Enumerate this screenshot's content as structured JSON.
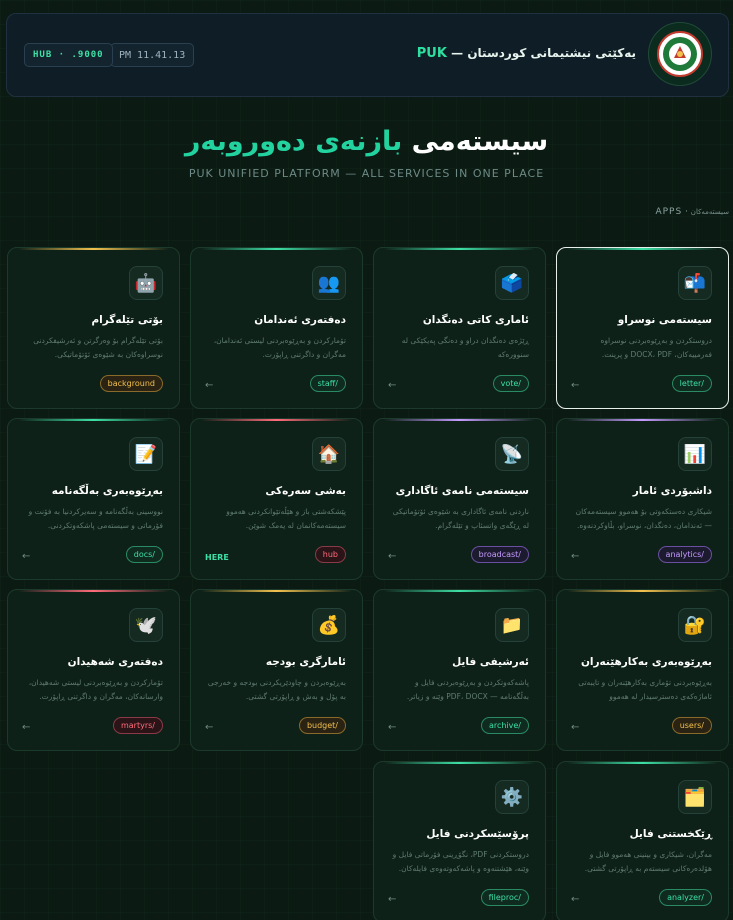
{
  "header": {
    "brand_name": "یەکێتی نیشتیمانی کوردستان",
    "brand_sep": " — ",
    "brand_short": "PUK",
    "time": "PM 11.41.13",
    "hub": "HUB · .9000"
  },
  "hero": {
    "title_part1": "سیستەمی",
    "title_part2": "بازنەی دەوروبەر",
    "subtitle": "PUK UNIFIED PLATFORM — ALL SERVICES IN ONE PLACE"
  },
  "apps_label": {
    "main": "APPS",
    "sep": " · ",
    "sub": "سیستەمەکان"
  },
  "cards": [
    {
      "title": "سیستەمی نوسراو",
      "desc": "دروستکردن و بەڕێوەبردنی نوسراوە فەرمییەکان، DOCX، PDF و پرینت.",
      "badge": "letter/",
      "arrow": "←",
      "icon": "📬",
      "icon_name": "mailbox-icon",
      "accent": "#3de0a6",
      "badge_style": "green"
    },
    {
      "title": "ئاماری کاتی دەنگدان",
      "desc": "ڕێژەی دەنگدان دراو و دەنگی پەیکێکی لە سنوورەکە",
      "badge": "vote/",
      "arrow": "←",
      "icon": "🗳️",
      "icon_name": "ballot-box-icon",
      "accent": "#3de0a6",
      "badge_style": "green"
    },
    {
      "title": "دەفتەری ئەندامان",
      "desc": "تۆمارکردن و بەڕێوەبردنی لیستی ئەندامان، مەگران و داگرتنی ڕاپۆرت.",
      "badge": "staff/",
      "arrow": "←",
      "icon": "👥",
      "icon_name": "people-icon",
      "accent": "#3de0a6",
      "badge_style": "green"
    },
    {
      "title": "بۆتی تێلەگرام",
      "desc": "بۆتی تێلەگرام بۆ وەرگرتن و ئەرشیفکردنی نوسراوەکان بە شێوەی ئۆتۆماتیکی.",
      "badge": "background",
      "arrow": "",
      "icon": "🤖",
      "icon_name": "robot-icon",
      "accent": "#f2c14e",
      "badge_style": "yellow"
    },
    {
      "title": "داشبۆردی ئامار",
      "desc": "شیکاری دەستکەوتی بۆ هەموو سیستەمەکان — ئەندامان، دەنگدان، نوسراو، بڵاوکردنەوە.",
      "badge": "analytics/",
      "arrow": "←",
      "icon": "📊",
      "icon_name": "bar-chart-icon",
      "accent": "#c59bff",
      "badge_style": "purple"
    },
    {
      "title": "سیستەمی نامەی ئاگاداری",
      "desc": "ناردنی نامەی ئاگاداری بە شێوەی ئۆتۆماتیکی لە ڕێگەی واتسئاپ و تێلەگرام.",
      "badge": "broadcast/",
      "arrow": "←",
      "icon": "📡",
      "icon_name": "satellite-dish-icon",
      "accent": "#c59bff",
      "badge_style": "purple"
    },
    {
      "title": "بەشی سەرەکی",
      "desc": "پێشکەشتی باز و هێڵەتێوانکردنی هەموو سیستەمەکانمان لە یەمک شوێن.",
      "badge": "hub",
      "arrow": "HERE",
      "icon": "🏠",
      "icon_name": "home-icon",
      "accent": "#ff6b7a",
      "badge_style": "red"
    },
    {
      "title": "بەڕێوەبەری بەڵگەنامە",
      "desc": "نووسینی بەڵگەنامە و سەیرکردنیا بە فۆنت و فۆرماتی و سیستەمی پاشکەوتکردنی.",
      "badge": "docs/",
      "arrow": "←",
      "icon": "📝",
      "icon_name": "memo-icon",
      "accent": "#3de0a6",
      "badge_style": "green"
    },
    {
      "title": "بەڕێوەبەری بەکارهێنەران",
      "desc": "بەڕێوەبردنی تۆماری بەکارهێنەران و تایبەتی ئاماژەکەی دەسترسیدار لە هەموو سیستەمەکان.",
      "badge": "users/",
      "arrow": "←",
      "icon": "🔐",
      "icon_name": "lock-key-icon",
      "accent": "#f2c14e",
      "badge_style": "yellow"
    },
    {
      "title": "ئەرشیفی فایل",
      "desc": "پاشەکەوتکردن و بەڕێوەبردنی فایل و بەڵگەنامە — PDF، DOCX وێنە و زیاتر.",
      "badge": "archive/",
      "arrow": "←",
      "icon": "📁",
      "icon_name": "folder-icon",
      "accent": "#3de0a6",
      "badge_style": "green"
    },
    {
      "title": "ئامارگری بودجە",
      "desc": "بەڕێوەبردن و چاودێریکردنی بودجە و خەرجی بە پۆل و بەش و ڕاپۆرتی گشتی.",
      "badge": "budget/",
      "arrow": "←",
      "icon": "💰",
      "icon_name": "money-bag-icon",
      "accent": "#f2c14e",
      "badge_style": "yellow"
    },
    {
      "title": "دەفتەری شەهیدان",
      "desc": "تۆمارکردن و بەڕێوەبردنی لیستی شەهیدان، وارسانەکان، مەگران و داگرتنی ڕاپۆرت.",
      "badge": "martyrs/",
      "arrow": "←",
      "icon": "🕊️",
      "icon_name": "dove-icon",
      "accent": "#ff6b7a",
      "badge_style": "red"
    },
    {
      "title": "ڕێکخستنی فایل",
      "desc": "مەگران، شیکاری و بینینی هەموو فایل و هۆلدەرەکانی سیستەم بە ڕاپۆرتی گشتی.",
      "badge": "analyzer/",
      "arrow": "←",
      "icon": "🗂️",
      "icon_name": "card-index-icon",
      "accent": "#3de0a6",
      "badge_style": "green"
    },
    {
      "title": "پرۆسێسکردنی فایل",
      "desc": "دروستکردنی PDF، نگۆڕینی فۆرماتی فایل و وێنە، هێشتنەوە و پاشەکەوتەوەی فایلەکان.",
      "badge": "fileproc/",
      "arrow": "←",
      "icon": "⚙️",
      "icon_name": "gear-icon",
      "accent": "#3de0a6",
      "badge_style": "green"
    }
  ]
}
